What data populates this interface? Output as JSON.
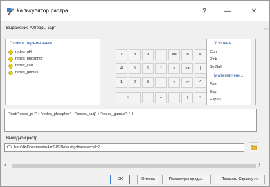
{
  "window": {
    "title": "Калькулятор растра",
    "controls": {
      "help": "?",
      "minimize": "—",
      "close": "✕"
    }
  },
  "section_label": "Выражение Алгебры карт",
  "layers_panel": {
    "header": "Слои и переменные",
    "items": [
      "redes_pH",
      "redes_phosphor",
      "redes_kalij",
      "redes_gumus"
    ],
    "icon_color": "#f2d100"
  },
  "keypad": {
    "rows": [
      [
        "7",
        "8",
        "9",
        "/",
        "==",
        "!=",
        "&"
      ],
      [
        "4",
        "5",
        "6",
        "*",
        ">",
        ">=",
        "|"
      ],
      [
        "1",
        "2",
        "3",
        "-",
        "<",
        "<=",
        "^"
      ],
      [
        "0",
        ".",
        "+",
        "(",
        ")",
        "~"
      ]
    ]
  },
  "functions_panel": {
    "group1": "Условия",
    "group1_items": [
      "Con",
      "Pick",
      "SetNull"
    ],
    "group2": "Математиче...",
    "group2_items": [
      "Abs",
      "Exp",
      "Exp10"
    ]
  },
  "expression": "Float(\"redes_pH\" + \"redes_phosphor\" + \"redes_kalij\" + \"redes_gumus\") / 4",
  "output": {
    "label": "Выходной растр",
    "value": "C:\\Users\\Ik\\Documents\\ArcGIS\\Default.gdb\\rastercalc2"
  },
  "buttons": {
    "ok": "OK",
    "cancel": "Отмена",
    "environments": "Параметры среды...",
    "help": "Показать Справку >>"
  },
  "colors": {
    "accent": "#1f4e9a",
    "ok_border": "#3c7fd0"
  }
}
